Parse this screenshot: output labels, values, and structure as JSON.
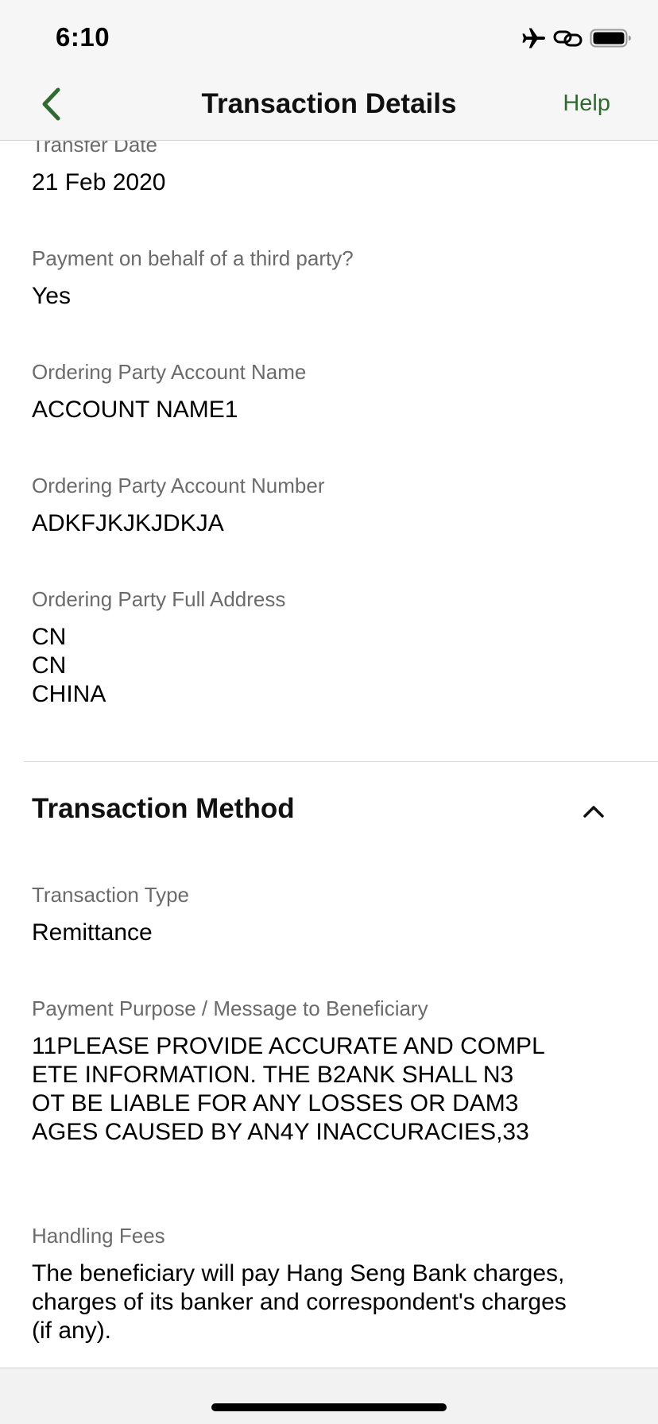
{
  "status_bar": {
    "time": "6:10",
    "icons": [
      "airplane-icon",
      "link-icon",
      "battery-icon"
    ]
  },
  "nav": {
    "back_icon": "chevron-left-icon",
    "title": "Transaction Details",
    "help_label": "Help"
  },
  "fields_top": [
    {
      "label": "Transfer Date",
      "value": "21 Feb 2020"
    },
    {
      "label": "Payment on behalf of a third party?",
      "value": "Yes"
    },
    {
      "label": "Ordering Party Account Name",
      "value": "ACCOUNT NAME1"
    },
    {
      "label": "Ordering Party Account Number",
      "value": "ADKFJKJKJDKJA"
    },
    {
      "label": "Ordering Party Full Address",
      "lines": [
        "CN",
        "CN",
        "CHINA"
      ]
    }
  ],
  "section": {
    "title": "Transaction Method",
    "toggle_icon": "chevron-up-icon"
  },
  "fields_method": [
    {
      "label": "Transaction Type",
      "value": "Remittance"
    },
    {
      "label": "Payment Purpose / Message to Beneficiary",
      "lines": [
        "11PLEASE PROVIDE ACCURATE AND COMPL",
        "ETE INFORMATION. THE B2ANK SHALL N3",
        "OT BE LIABLE FOR ANY LOSSES OR DAM3",
        "AGES CAUSED BY AN4Y INACCURACIES,33"
      ]
    },
    {
      "label": "Handling Fees",
      "lines": [
        "The beneficiary will pay Hang Seng Bank charges,",
        "charges of its banker and correspondent's charges",
        "(if any)."
      ]
    }
  ],
  "colors": {
    "accent": "#2f6b2f",
    "label_gray": "#6b6b6b",
    "topbar_bg": "#f6f6f6"
  }
}
